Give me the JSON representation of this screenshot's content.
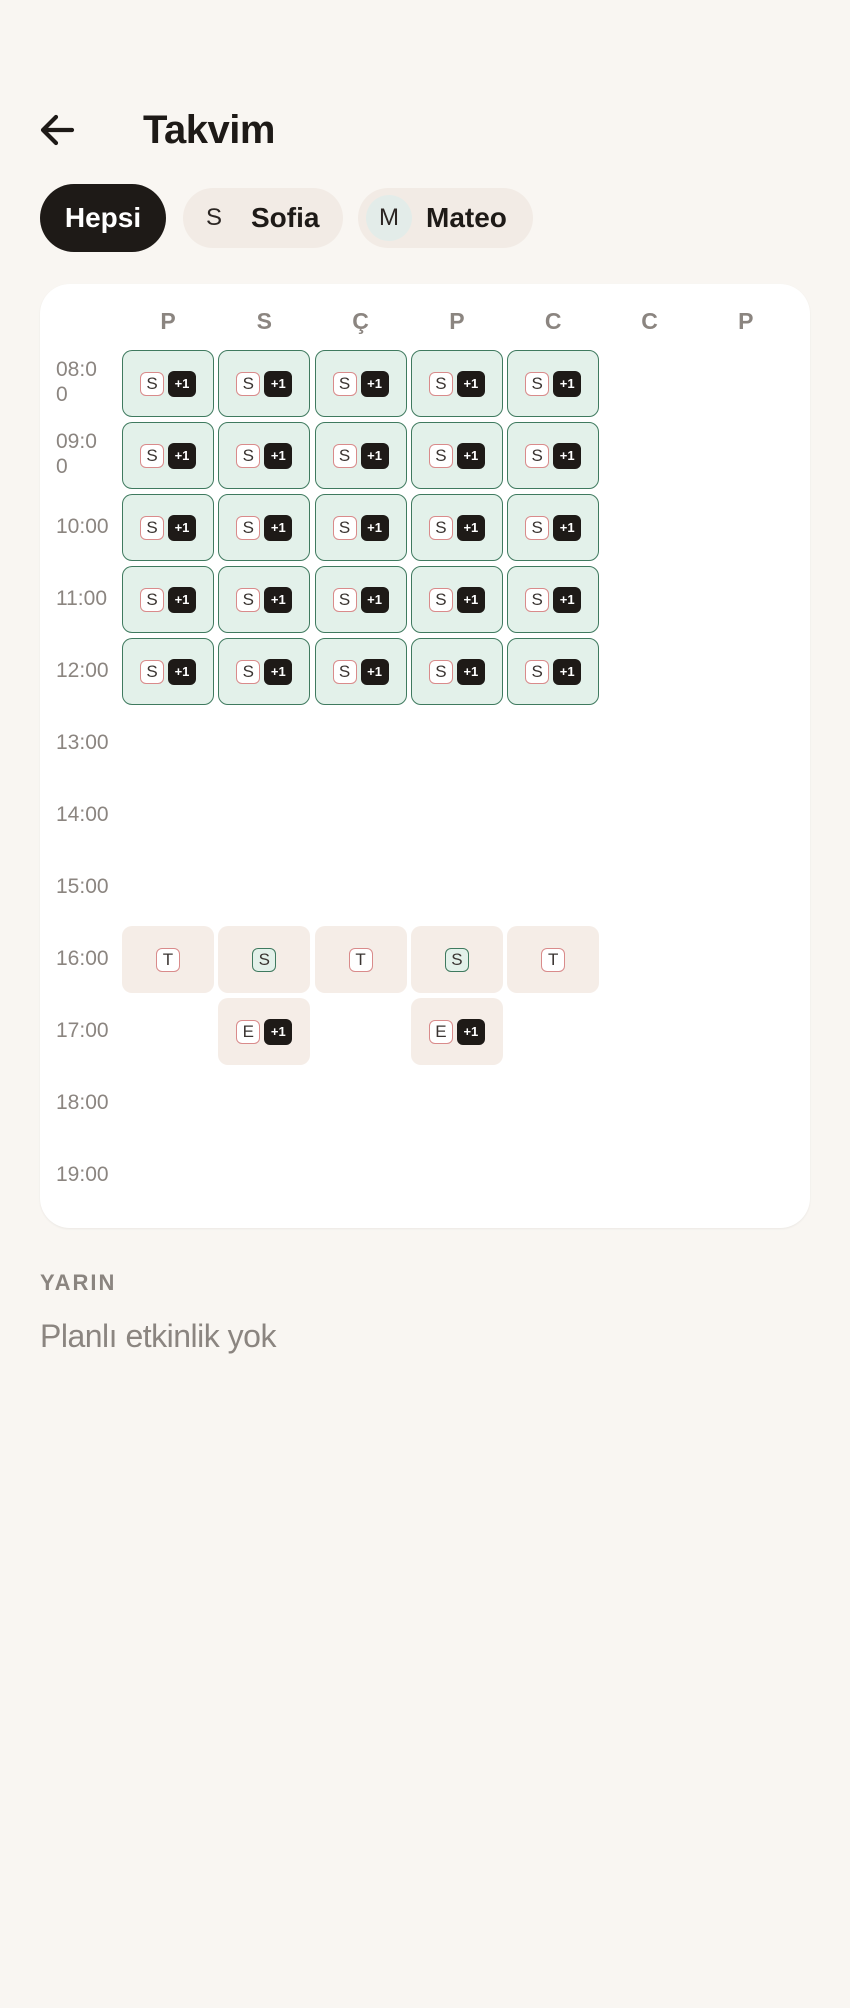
{
  "header": {
    "title": "Takvim",
    "back_icon": "arrow-left-icon"
  },
  "filters": [
    {
      "label": "Hepsi",
      "selected": true
    },
    {
      "label": "Sofia",
      "initial": "S",
      "selected": false
    },
    {
      "label": "Mateo",
      "initial": "M",
      "selected": false
    }
  ],
  "calendar": {
    "days": [
      "P",
      "S",
      "Ç",
      "P",
      "C",
      "C",
      "P"
    ],
    "times": [
      "08:00",
      "09:00",
      "10:00",
      "11:00",
      "12:00",
      "13:00",
      "14:00",
      "15:00",
      "16:00",
      "17:00",
      "18:00",
      "19:00"
    ],
    "time_display": [
      "08:0\n0",
      "09:0\n0",
      "10:00",
      "11:00",
      "12:00",
      "13:00",
      "14:00",
      "15:00",
      "16:00",
      "17:00",
      "18:00",
      "19:00"
    ],
    "events": [
      {
        "day": 0,
        "time": 0,
        "style": "green",
        "tag": "S",
        "tag_color": "red",
        "extra": "+1"
      },
      {
        "day": 1,
        "time": 0,
        "style": "green",
        "tag": "S",
        "tag_color": "red",
        "extra": "+1"
      },
      {
        "day": 2,
        "time": 0,
        "style": "green",
        "tag": "S",
        "tag_color": "red",
        "extra": "+1"
      },
      {
        "day": 3,
        "time": 0,
        "style": "green",
        "tag": "S",
        "tag_color": "red",
        "extra": "+1"
      },
      {
        "day": 4,
        "time": 0,
        "style": "green",
        "tag": "S",
        "tag_color": "red",
        "extra": "+1"
      },
      {
        "day": 0,
        "time": 1,
        "style": "green",
        "tag": "S",
        "tag_color": "red",
        "extra": "+1"
      },
      {
        "day": 1,
        "time": 1,
        "style": "green",
        "tag": "S",
        "tag_color": "red",
        "extra": "+1"
      },
      {
        "day": 2,
        "time": 1,
        "style": "green",
        "tag": "S",
        "tag_color": "red",
        "extra": "+1"
      },
      {
        "day": 3,
        "time": 1,
        "style": "green",
        "tag": "S",
        "tag_color": "red",
        "extra": "+1"
      },
      {
        "day": 4,
        "time": 1,
        "style": "green",
        "tag": "S",
        "tag_color": "red",
        "extra": "+1"
      },
      {
        "day": 0,
        "time": 2,
        "style": "green",
        "tag": "S",
        "tag_color": "red",
        "extra": "+1"
      },
      {
        "day": 1,
        "time": 2,
        "style": "green",
        "tag": "S",
        "tag_color": "red",
        "extra": "+1"
      },
      {
        "day": 2,
        "time": 2,
        "style": "green",
        "tag": "S",
        "tag_color": "red",
        "extra": "+1"
      },
      {
        "day": 3,
        "time": 2,
        "style": "green",
        "tag": "S",
        "tag_color": "red",
        "extra": "+1"
      },
      {
        "day": 4,
        "time": 2,
        "style": "green",
        "tag": "S",
        "tag_color": "red",
        "extra": "+1"
      },
      {
        "day": 0,
        "time": 3,
        "style": "green",
        "tag": "S",
        "tag_color": "red",
        "extra": "+1"
      },
      {
        "day": 1,
        "time": 3,
        "style": "green",
        "tag": "S",
        "tag_color": "red",
        "extra": "+1"
      },
      {
        "day": 2,
        "time": 3,
        "style": "green",
        "tag": "S",
        "tag_color": "red",
        "extra": "+1"
      },
      {
        "day": 3,
        "time": 3,
        "style": "green",
        "tag": "S",
        "tag_color": "red",
        "extra": "+1"
      },
      {
        "day": 4,
        "time": 3,
        "style": "green",
        "tag": "S",
        "tag_color": "red",
        "extra": "+1"
      },
      {
        "day": 0,
        "time": 4,
        "style": "green",
        "tag": "S",
        "tag_color": "red",
        "extra": "+1"
      },
      {
        "day": 1,
        "time": 4,
        "style": "green",
        "tag": "S",
        "tag_color": "red",
        "extra": "+1"
      },
      {
        "day": 2,
        "time": 4,
        "style": "green",
        "tag": "S",
        "tag_color": "red",
        "extra": "+1"
      },
      {
        "day": 3,
        "time": 4,
        "style": "green",
        "tag": "S",
        "tag_color": "red",
        "extra": "+1"
      },
      {
        "day": 4,
        "time": 4,
        "style": "green",
        "tag": "S",
        "tag_color": "red",
        "extra": "+1"
      },
      {
        "day": 0,
        "time": 8,
        "style": "beige",
        "tag": "T",
        "tag_color": "red"
      },
      {
        "day": 1,
        "time": 8,
        "style": "beige",
        "tag": "S",
        "tag_color": "green"
      },
      {
        "day": 2,
        "time": 8,
        "style": "beige",
        "tag": "T",
        "tag_color": "red"
      },
      {
        "day": 3,
        "time": 8,
        "style": "beige",
        "tag": "S",
        "tag_color": "green"
      },
      {
        "day": 4,
        "time": 8,
        "style": "beige",
        "tag": "T",
        "tag_color": "red"
      },
      {
        "day": 1,
        "time": 9,
        "style": "beige",
        "tag": "E",
        "tag_color": "red",
        "extra": "+1"
      },
      {
        "day": 3,
        "time": 9,
        "style": "beige",
        "tag": "E",
        "tag_color": "red",
        "extra": "+1"
      }
    ]
  },
  "tomorrow": {
    "heading": "YARIN",
    "empty_text": "Planlı etkinlik yok"
  },
  "colors": {
    "background": "#f9f6f2",
    "primary": "#1e1a17",
    "green_fill": "#e3f1ea",
    "green_border": "#3f7a5f",
    "beige_fill": "#f5ede7",
    "tag_red": "#d98b8b",
    "muted_text": "#8b8580"
  }
}
